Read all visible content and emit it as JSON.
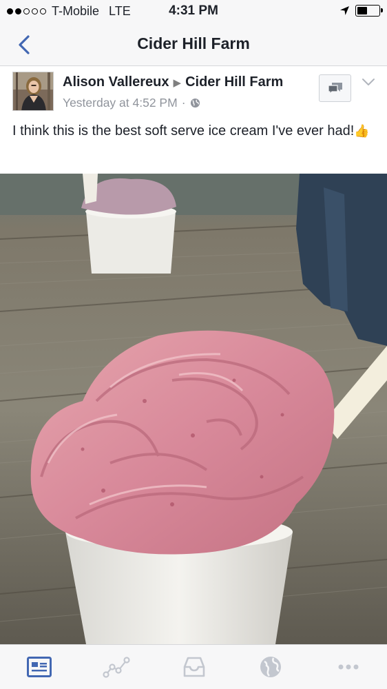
{
  "status_bar": {
    "carrier": "T-Mobile",
    "network": "LTE",
    "time": "4:31 PM",
    "signal_bars_filled": 2,
    "signal_bars_total": 5,
    "battery_level": 0.45
  },
  "nav": {
    "title": "Cider Hill Farm",
    "back_icon": "chevron-left-icon"
  },
  "post": {
    "author": "Alison Vallereux",
    "arrow": "▶",
    "target": "Cider Hill Farm",
    "timestamp": "Yesterday at 4:52 PM",
    "separator": "·",
    "audience_icon": "globe-icon",
    "text": "I think this is the best soft serve ice cream I've ever had!",
    "emoji": "👍"
  },
  "tabs": [
    {
      "icon": "news-feed-icon",
      "active": true
    },
    {
      "icon": "activity-icon",
      "active": false
    },
    {
      "icon": "inbox-icon",
      "active": false
    },
    {
      "icon": "globe-icon",
      "active": false
    },
    {
      "icon": "more-icon",
      "active": false
    }
  ],
  "colors": {
    "accent": "#4267b2",
    "inactive": "#c3c7cf",
    "text": "#1d2129",
    "secondary": "#90949c"
  }
}
